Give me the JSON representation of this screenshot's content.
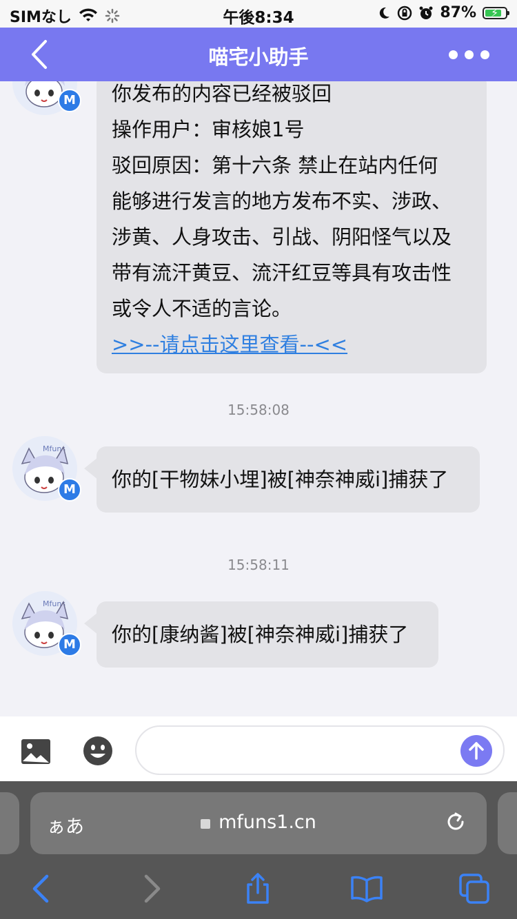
{
  "status_bar": {
    "carrier": "SIMなし",
    "time": "午後8:34",
    "battery_percent": "87%",
    "battery_level": 0.87,
    "icons": [
      "wifi-icon",
      "loading-icon",
      "moon-icon",
      "rotation-lock-icon",
      "alarm-icon",
      "battery-charging-icon"
    ]
  },
  "nav": {
    "title": "喵宅小助手",
    "back_icon": "chevron-left-icon",
    "more_icon": "more-dots-icon"
  },
  "messages": [
    {
      "lines": [
        "你发布的内容已经被驳回",
        "操作用户：审核娘1号",
        "驳回原因：第十六条 禁止在站内任何",
        "能够进行发言的地方发布不实、涉政、",
        "涉黄、人身攻击、引战、阴阳怪气以及",
        "带有流汗黄豆、流汗红豆等具有攻击性",
        "或令人不适的言论。"
      ],
      "link": ">>--请点击这里查看--<<"
    },
    {
      "timestamp": "15:58:08",
      "text": "你的[干物妹小埋]被[神奈神威i]捕获了"
    },
    {
      "timestamp": "15:58:11",
      "text": "你的[康纳酱]被[神奈神威i]捕获了"
    }
  ],
  "avatar": {
    "badge": "M",
    "label": "Mfuns"
  },
  "input": {
    "placeholder": "",
    "image_icon": "image-icon",
    "emoji_icon": "emoji-icon",
    "send_icon": "send-arrow-icon"
  },
  "safari": {
    "aa_label": "ぁあ",
    "url": "mfuns1.cn",
    "toolbar": [
      "back-arrow-icon",
      "forward-arrow-icon",
      "share-icon",
      "bookmarks-icon",
      "tabs-icon"
    ]
  },
  "colors": {
    "nav_bg": "#7878f0",
    "bubble_bg": "#e3e3e7",
    "link": "#2f7fe0",
    "badge": "#2d7be6",
    "toolbar_icon": "#3b82f6"
  }
}
